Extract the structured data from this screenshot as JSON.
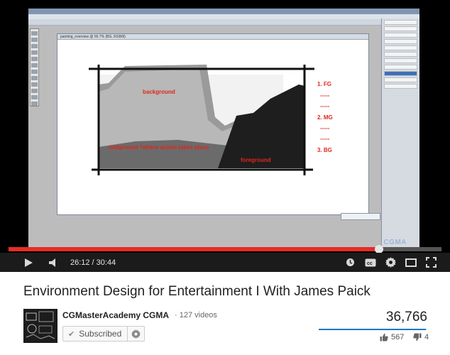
{
  "video": {
    "canvas_window_title": "painting_overview @ 66.7% (BG, RGB/8)",
    "annotations": {
      "background": "background",
      "midground": "midground *where action takes place",
      "foreground": "foreground",
      "list_fg": "1. FG",
      "list_dashes_1": "-----",
      "list_dashes_2": "-----",
      "list_mg": "2.  MG",
      "list_dashes_3": "-----",
      "list_dashes_4": "-----",
      "list_bg": "3. BG"
    },
    "watermark": "CGMA",
    "progress_fraction": 0.855
  },
  "controls": {
    "current_time": "26:12",
    "time_separator": "/",
    "total_time": "30:44",
    "play_icon": "play-icon",
    "volume_icon": "volume-icon"
  },
  "info": {
    "title": "Environment Design for Entertainment I With James Paick",
    "channel_name": "CGMasterAcademy CGMA",
    "video_count": "· 127 videos",
    "subscribe_label": "Subscribed",
    "view_count": "36,766",
    "likes": "567",
    "dislikes": "4",
    "like_fraction": 0.993
  },
  "colors": {
    "progress_red": "#e52d27",
    "annotation_red": "#e0261b",
    "sentiment_blue": "#167ac6"
  }
}
